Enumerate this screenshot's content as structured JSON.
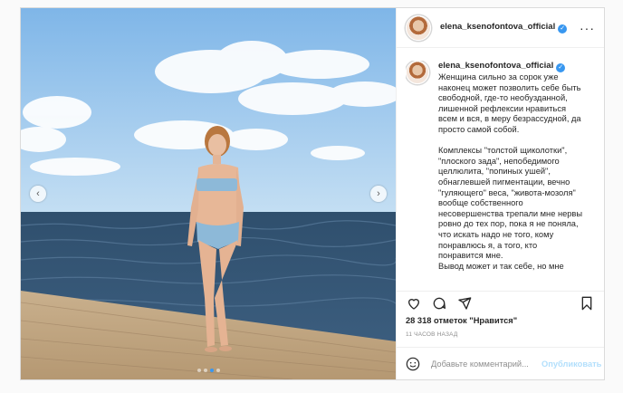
{
  "post": {
    "username": "elena_ksenofontova_official",
    "more_icon": "more-horizontal-icon",
    "caption": {
      "username": "elena_ksenofontova_official",
      "paragraph1": [
        "Женщина сильно за сорок уже",
        "наконец может позволить себе быть",
        "свободной, где-то необузданной,",
        "лишенной рефлексии нравиться",
        "всем и вся, в меру безрассудной, да",
        "просто самой собой."
      ],
      "paragraph2": [
        "Комплексы \"толстой щиколотки\",",
        "\"плоского зада\", непобедимого",
        "целлюлита, \"попиных ушей\",",
        "обнаглевшей пигментации, вечно",
        "\"гуляющего\" веса, \"живота-мозоля\"",
        "вообще собственного",
        "несовершенства трепали мне нервы",
        "ровно до тех пор, пока я не поняла,",
        "что искать надо не того, кому",
        "понравлюсь я, а того, кто",
        "понравится мне.",
        "Вывод может и так себе, но мне"
      ]
    },
    "likes": "28 318 отметок \"Нравится\"",
    "time_ago": "11 ЧАСОВ НАЗАД",
    "comment_placeholder": "Добавьте комментарий...",
    "publish_label": "Опубликовать",
    "carousel": {
      "total": 4,
      "active_index": 2
    },
    "colors": {
      "verified": "#3897f0",
      "publish_disabled": "#b2dffc",
      "accent": "#3897f0"
    },
    "icons": [
      "heart-icon",
      "comment-icon",
      "share-icon",
      "bookmark-icon",
      "emoji-icon",
      "chevron-left-icon",
      "chevron-right-icon",
      "verified-icon"
    ]
  }
}
